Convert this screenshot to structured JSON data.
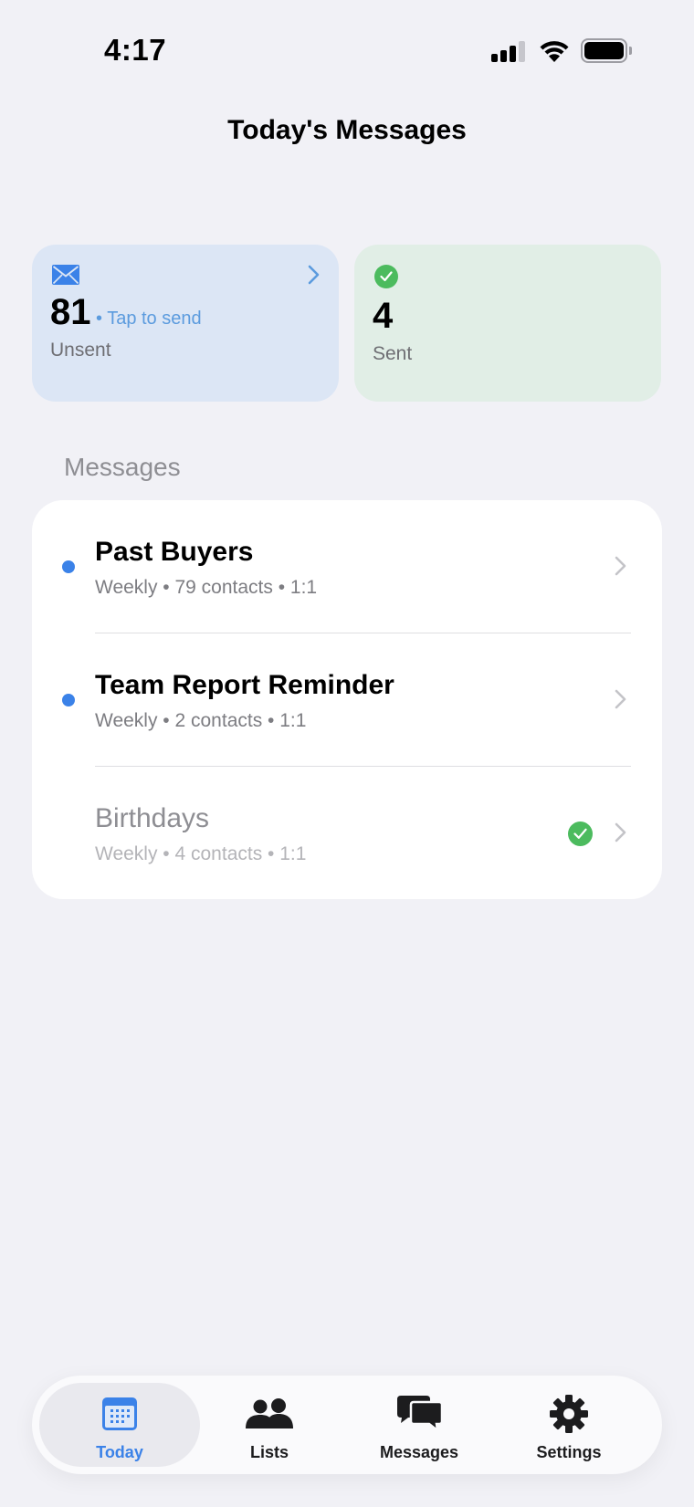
{
  "status_bar": {
    "time": "4:17"
  },
  "header": {
    "title": "Today's Messages"
  },
  "summary": {
    "unsent": {
      "count": "81",
      "action": "• Tap to send",
      "label": "Unsent"
    },
    "sent": {
      "count": "4",
      "label": "Sent"
    }
  },
  "section": {
    "title": "Messages"
  },
  "messages": [
    {
      "title": "Past Buyers",
      "subtitle": "Weekly • 79 contacts • 1:1",
      "unread": true,
      "done": false
    },
    {
      "title": "Team Report Reminder",
      "subtitle": "Weekly • 2 contacts • 1:1",
      "unread": true,
      "done": false
    },
    {
      "title": "Birthdays",
      "subtitle": "Weekly • 4 contacts • 1:1",
      "unread": false,
      "done": true
    }
  ],
  "tabs": [
    {
      "label": "Today",
      "icon": "calendar-icon",
      "active": true
    },
    {
      "label": "Lists",
      "icon": "people-icon",
      "active": false
    },
    {
      "label": "Messages",
      "icon": "chat-bubbles-icon",
      "active": false
    },
    {
      "label": "Settings",
      "icon": "gear-icon",
      "active": false
    }
  ],
  "colors": {
    "accent": "#3b82e8",
    "success": "#4cbb5e",
    "background": "#f1f1f6"
  }
}
